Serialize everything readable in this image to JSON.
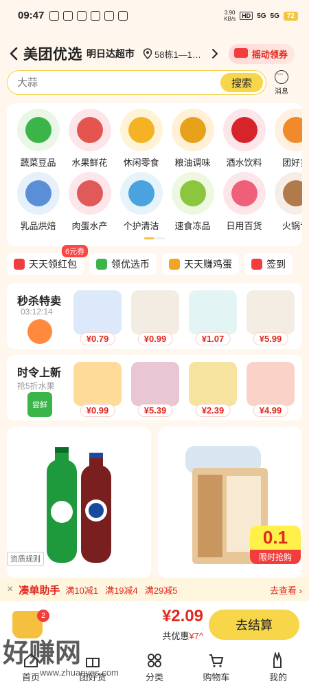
{
  "status_bar": {
    "time": "09:47",
    "speed_value": "3.90",
    "speed_unit": "KB/s",
    "battery": "72",
    "network_hd": "HD",
    "network_5g_a": "5G",
    "network_5g_b": "5G"
  },
  "header": {
    "brand": "美团优选",
    "store": "明日达超市",
    "location": "58栋1—1…",
    "shake_label": "摇动领券"
  },
  "search": {
    "placeholder": "大蒜",
    "button": "搜索",
    "message_label": "消息"
  },
  "categories": [
    {
      "label": "蔬菜豆品",
      "color": "#eaf7e6",
      "accent": "#3bb54a"
    },
    {
      "label": "水果鲜花",
      "color": "#fde6ea",
      "accent": "#e4554f"
    },
    {
      "label": "休闲零食",
      "color": "#fff3d6",
      "accent": "#f4b224"
    },
    {
      "label": "粮油调味",
      "color": "#fff0d6",
      "accent": "#e8a11a"
    },
    {
      "label": "酒水饮料",
      "color": "#fde6ea",
      "accent": "#d7232a"
    },
    {
      "label": "团好货",
      "color": "#fff0e0",
      "accent": "#f08a2a"
    },
    {
      "label": "乳品烘焙",
      "color": "#e6f0fb",
      "accent": "#5a8fd8"
    },
    {
      "label": "肉蛋水产",
      "color": "#fde6ea",
      "accent": "#e05a5a"
    },
    {
      "label": "个护清洁",
      "color": "#e6f3fb",
      "accent": "#4aa3df"
    },
    {
      "label": "速食冻品",
      "color": "#eef7e0",
      "accent": "#8cc63f"
    },
    {
      "label": "日用百货",
      "color": "#fde6ea",
      "accent": "#ef5f7a"
    },
    {
      "label": "火锅专",
      "color": "#f6eee6",
      "accent": "#b07a4a"
    }
  ],
  "promos": [
    {
      "label": "天天领红包",
      "color": "#f23d3d",
      "badge": "6元券"
    },
    {
      "label": "领优选币",
      "color": "#3bb54a",
      "badge": ""
    },
    {
      "label": "天天赚鸡蛋",
      "color": "#f4a424",
      "badge": ""
    },
    {
      "label": "签到",
      "color": "#f23d3d",
      "badge": ""
    }
  ],
  "flash_sale": {
    "title": "秒杀特卖",
    "countdown": "03:12:14",
    "products": [
      {
        "price": "¥0.79",
        "color": "#dbe9fb"
      },
      {
        "price": "¥0.99",
        "color": "#f3ece2"
      },
      {
        "price": "¥1.07",
        "color": "#e2f4f3"
      },
      {
        "price": "¥5.99",
        "color": "#f3ede4"
      }
    ]
  },
  "seasonal": {
    "title": "时令上新",
    "subtitle": "抢5折水果",
    "icon_label": "尝鲜",
    "products": [
      {
        "price": "¥0.99",
        "color": "#ffdb99"
      },
      {
        "price": "¥5.39",
        "color": "#e9c6d3"
      },
      {
        "price": "¥2.39",
        "color": "#f7e3a0"
      },
      {
        "price": "¥4.99",
        "color": "#fbd2c8"
      }
    ]
  },
  "big_cards": {
    "left": {
      "qualification": "资质规则"
    },
    "right": {
      "flash_price": "0.1",
      "flash_label": "限时抢购"
    }
  },
  "helper": {
    "title": "凑单助手",
    "items": [
      "满10减1",
      "满19减4",
      "满29减5"
    ],
    "more": "去查看 ›"
  },
  "cart": {
    "count": "2",
    "total": "¥2.09",
    "savings_label": "共优惠",
    "savings_value": "¥7",
    "checkout": "去结算"
  },
  "tabs": [
    "首页",
    "团好货",
    "分类",
    "购物车",
    "我的"
  ],
  "watermark": {
    "text": "好赚网",
    "url": "www.zhuanyes.com"
  }
}
